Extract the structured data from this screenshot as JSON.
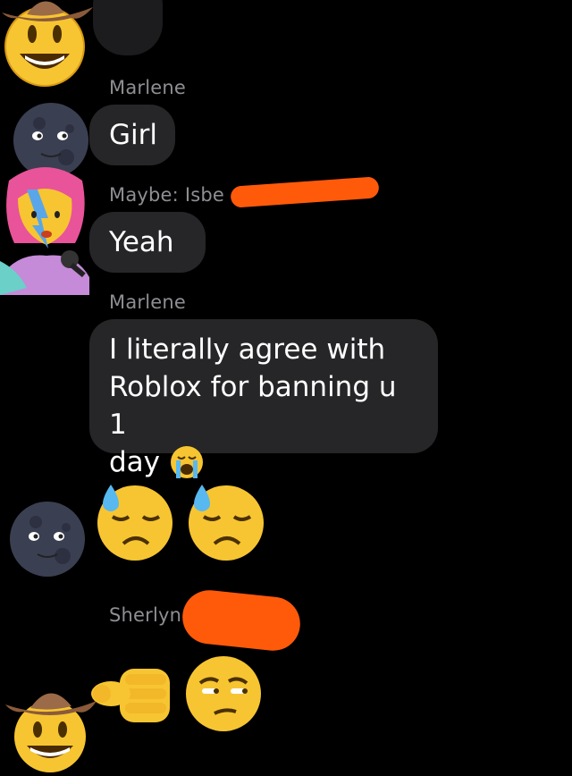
{
  "messages": [
    {
      "sender": "Marlene",
      "text": "Girl"
    },
    {
      "sender": "Maybe: Isbe",
      "text": "Yeah"
    },
    {
      "sender": "Marlene",
      "text_lines": [
        "I literally agree with",
        "Roblox for banning u 1",
        "day"
      ],
      "trailing_emoji": "loudly-crying-face"
    },
    {
      "sender": "",
      "emojis": [
        "downcast-face-with-sweat",
        "downcast-face-with-sweat"
      ]
    },
    {
      "sender": "Sherlyn",
      "emojis": [
        "backhand-index-pointing-at-viewer",
        "unamused-face"
      ]
    }
  ],
  "avatars": [
    "cowboy-hat-face",
    "new-moon-face",
    "woman-singer",
    "new-moon-face",
    "cowboy-hat-face"
  ],
  "colors": {
    "background": "#000000",
    "bubble": "#262628",
    "sender_name": "#8e8e93",
    "redaction": "#ff5a0a"
  }
}
